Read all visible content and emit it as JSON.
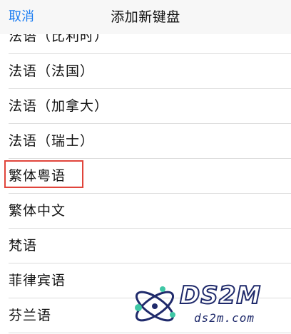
{
  "navbar": {
    "cancel_label": "取消",
    "title": "添加新键盘"
  },
  "keyboards": [
    "法语（比利时）",
    "法语（法国）",
    "法语（加拿大）",
    "法语（瑞士）",
    "繁体粤语",
    "繁体中文",
    "梵语",
    "菲律宾语",
    "芬兰语"
  ],
  "highlighted_item": "繁体粤语",
  "watermark": {
    "brand": "DS2M",
    "domain": "ds2m.com"
  },
  "colors": {
    "accent": "#1a7cf2",
    "highlight_border": "#e0443b",
    "separator": "#dcdcdc",
    "watermark": "#1f2a6b"
  }
}
